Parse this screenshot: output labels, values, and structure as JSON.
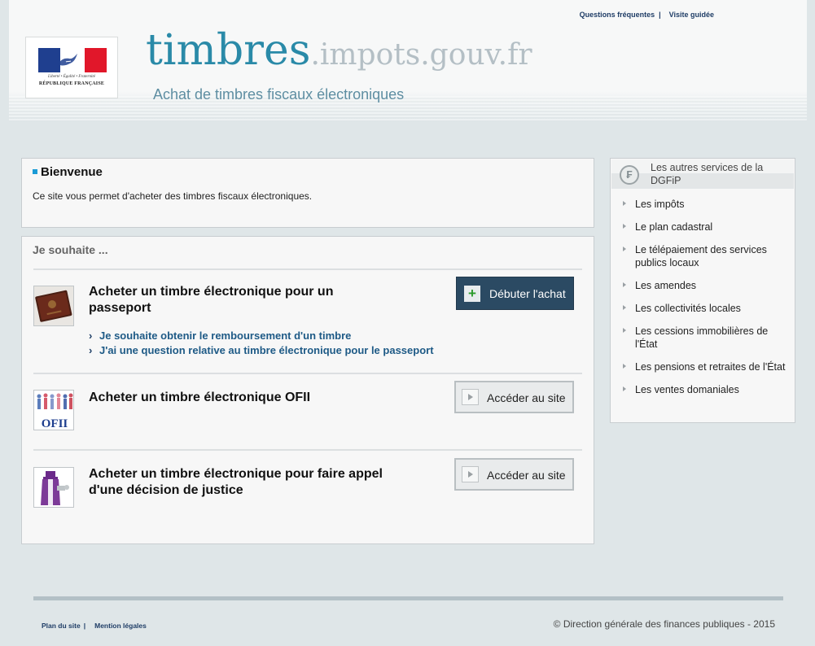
{
  "header": {
    "top_links": [
      "Questions fréquentes",
      "Visite guidée"
    ],
    "logo": {
      "motto": "Liberté • Égalité • Fraternité",
      "country": "RÉPUBLIQUE FRANÇAISE",
      "flag_colors": [
        "#1f3f8f",
        "#ffffff",
        "#e1172a"
      ]
    },
    "brand_main": "timbres",
    "brand_domain": ".impots.gouv.fr",
    "tagline": "Achat de timbres fiscaux électroniques"
  },
  "welcome": {
    "title": "Bienvenue",
    "text": "Ce site vous permet d'acheter des timbres fiscaux électroniques."
  },
  "wish": {
    "heading": "Je souhaite ...",
    "items": [
      {
        "title": "Acheter un timbre électronique pour un passeport",
        "button": "Débuter l'achat",
        "icon": "passport-icon",
        "links": [
          "Je souhaite obtenir le remboursement d'un timbre",
          "J'ai une question relative au timbre électronique pour le passeport"
        ]
      },
      {
        "title": "Acheter un timbre électronique OFII",
        "button": "Accéder au site",
        "icon": "ofii-icon",
        "icon_text": "OFII"
      },
      {
        "title": "Acheter un timbre électronique pour faire appel d'une décision de justice",
        "button": "Accéder au site",
        "icon": "justice-icon"
      }
    ]
  },
  "sidebar": {
    "title": "Les autres services de la DGFiP",
    "icon": "franc-coin-icon",
    "items": [
      "Les impôts",
      "Le plan cadastral",
      "Le télépaiement des services publics locaux",
      "Les amendes",
      "Les collectivités locales",
      "Les cessions immobilières de l'État",
      "Les pensions et retraites de l'État",
      "Les ventes domaniales"
    ]
  },
  "footer": {
    "links": [
      "Plan du site",
      "Mention légales"
    ],
    "copyright": "© Direction générale des finances publiques - 2015"
  },
  "colors": {
    "accent": "#2a8aa8",
    "button_dark": "#2b4a63",
    "link": "#1e5a86",
    "background": "#dfe6e8"
  }
}
